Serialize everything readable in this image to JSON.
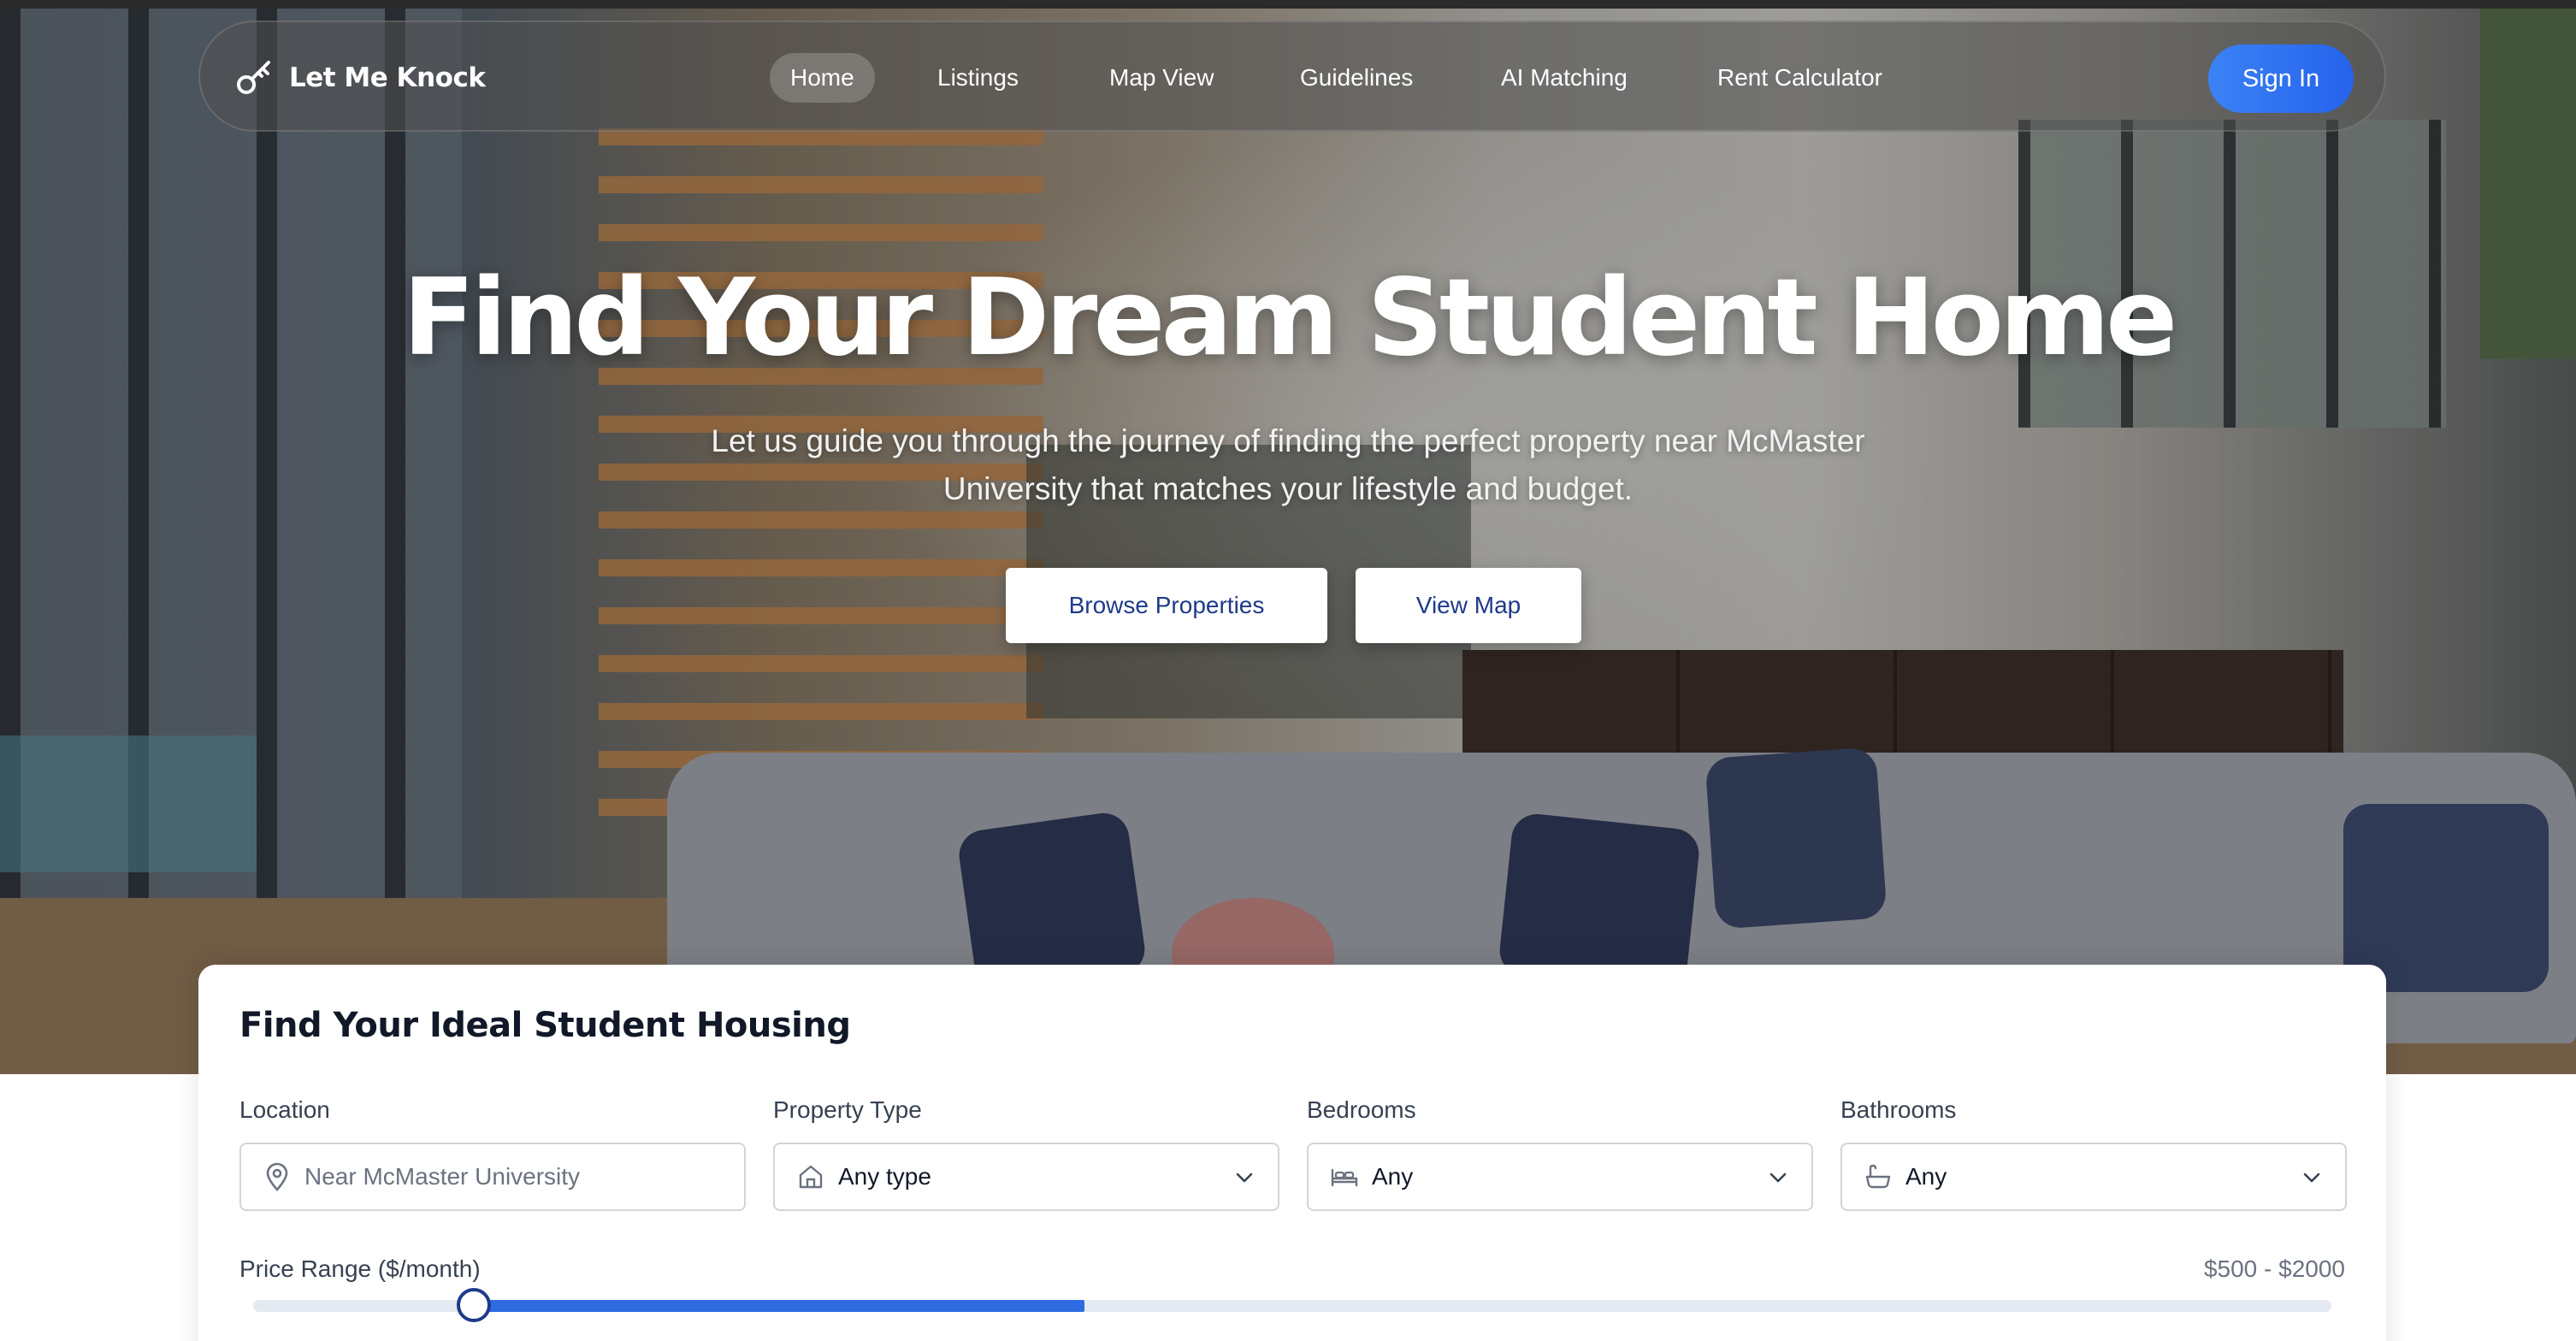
{
  "brand": {
    "name": "Let Me Knock",
    "icon": "key-icon"
  },
  "nav": {
    "items": [
      {
        "label": "Home",
        "active": true
      },
      {
        "label": "Listings",
        "active": false
      },
      {
        "label": "Map View",
        "active": false
      },
      {
        "label": "Guidelines",
        "active": false
      },
      {
        "label": "AI Matching",
        "active": false
      },
      {
        "label": "Rent Calculator",
        "active": false
      }
    ],
    "signin_label": "Sign In"
  },
  "hero": {
    "title": "Find Your Dream Student Home",
    "subtitle": "Let us guide you through the journey of finding the perfect property near McMaster University that matches your lifestyle and budget.",
    "browse_label": "Browse Properties",
    "map_label": "View Map"
  },
  "search": {
    "title": "Find Your Ideal Student Housing",
    "location": {
      "label": "Location",
      "placeholder": "Near McMaster University",
      "icon": "map-pin-icon"
    },
    "property_type": {
      "label": "Property Type",
      "value": "Any type",
      "icon": "home-icon"
    },
    "bedrooms": {
      "label": "Bedrooms",
      "value": "Any",
      "icon": "bed-icon"
    },
    "bathrooms": {
      "label": "Bathrooms",
      "value": "Any",
      "icon": "bath-icon"
    },
    "price": {
      "label": "Price Range ($/month)",
      "value_text": "$500 - $2000",
      "selected_start": 0.106,
      "selected_end": 0.4
    }
  },
  "colors": {
    "accent": "#2563eb",
    "slider_fill": "#2f6be0",
    "button_text": "#1e3a8a"
  }
}
